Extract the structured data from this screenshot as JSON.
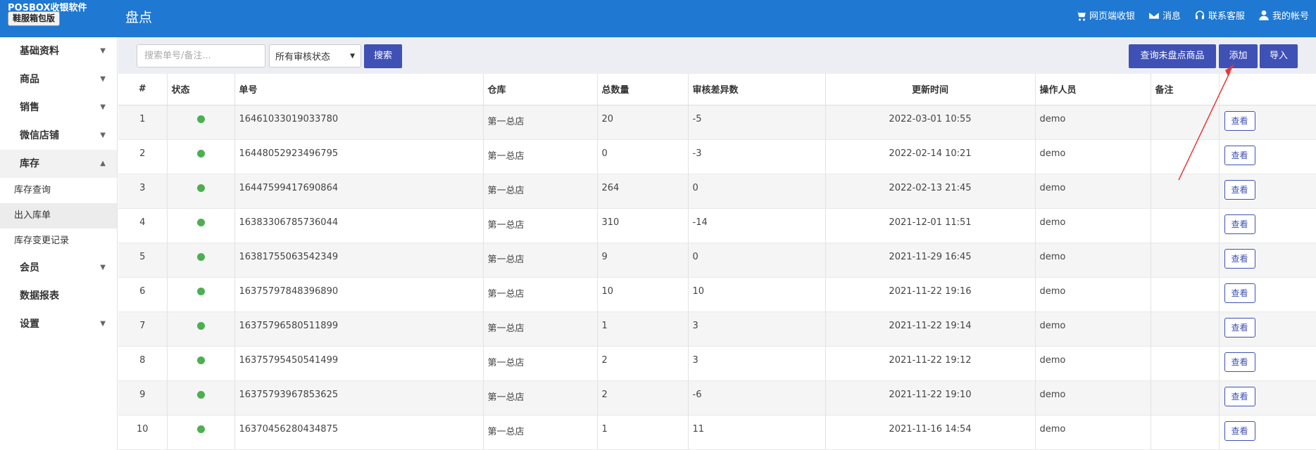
{
  "header": {
    "brand": "POSBOX收银软件",
    "store_type": "鞋服箱包版",
    "page_title": "盘点",
    "nav": [
      {
        "label": "网页端收银",
        "icon": "cart-icon"
      },
      {
        "label": "消息",
        "icon": "mail-icon"
      },
      {
        "label": "联系客服",
        "icon": "headset-icon"
      },
      {
        "label": "我的帐号",
        "icon": "user-icon"
      }
    ]
  },
  "sidebar": {
    "items": [
      {
        "label": "基础资料",
        "caret": "▼"
      },
      {
        "label": "商品",
        "caret": "▼"
      },
      {
        "label": "销售",
        "caret": "▼"
      },
      {
        "label": "微信店铺",
        "caret": "▼"
      },
      {
        "label": "库存",
        "caret": "▲"
      }
    ],
    "sub_items": [
      {
        "label": "库存查询"
      },
      {
        "label": "出入库单"
      },
      {
        "label": "库存变更记录"
      }
    ],
    "items_after": [
      {
        "label": "会员",
        "caret": "▼"
      },
      {
        "label": "数据报表",
        "caret": ""
      },
      {
        "label": "设置",
        "caret": "▼"
      }
    ]
  },
  "toolbar": {
    "search_placeholder": "搜索单号/备注...",
    "status_select": "所有审核状态",
    "search_btn": "搜索",
    "uncounted_btn": "查询未盘点商品",
    "add_btn": "添加",
    "import_btn": "导入"
  },
  "table": {
    "headers": [
      "#",
      "状态",
      "单号",
      "仓库",
      "总数量",
      "审核差异数",
      "更新时间",
      "操作人员",
      "备注",
      ""
    ],
    "view_label": "查看",
    "status_color": "#4caf50",
    "rows": [
      {
        "idx": "1",
        "no": "16461033019033780",
        "warehouse": "第一总店",
        "qty": "20",
        "diff": "-5",
        "time": "2022-03-01 10:55",
        "operator": "demo",
        "note": ""
      },
      {
        "idx": "2",
        "no": "16448052923496795",
        "warehouse": "第一总店",
        "qty": "0",
        "diff": "-3",
        "time": "2022-02-14 10:21",
        "operator": "demo",
        "note": ""
      },
      {
        "idx": "3",
        "no": "16447599417690864",
        "warehouse": "第一总店",
        "qty": "264",
        "diff": "0",
        "time": "2022-02-13 21:45",
        "operator": "demo",
        "note": ""
      },
      {
        "idx": "4",
        "no": "16383306785736044",
        "warehouse": "第一总店",
        "qty": "310",
        "diff": "-14",
        "time": "2021-12-01 11:51",
        "operator": "demo",
        "note": ""
      },
      {
        "idx": "5",
        "no": "16381755063542349",
        "warehouse": "第一总店",
        "qty": "9",
        "diff": "0",
        "time": "2021-11-29 16:45",
        "operator": "demo",
        "note": ""
      },
      {
        "idx": "6",
        "no": "16375797848396890",
        "warehouse": "第一总店",
        "qty": "10",
        "diff": "10",
        "time": "2021-11-22 19:16",
        "operator": "demo",
        "note": ""
      },
      {
        "idx": "7",
        "no": "16375796580511899",
        "warehouse": "第一总店",
        "qty": "1",
        "diff": "3",
        "time": "2021-11-22 19:14",
        "operator": "demo",
        "note": ""
      },
      {
        "idx": "8",
        "no": "16375795450541499",
        "warehouse": "第一总店",
        "qty": "2",
        "diff": "3",
        "time": "2021-11-22 19:12",
        "operator": "demo",
        "note": ""
      },
      {
        "idx": "9",
        "no": "16375793967853625",
        "warehouse": "第一总店",
        "qty": "2",
        "diff": "-6",
        "time": "2021-11-22 19:10",
        "operator": "demo",
        "note": ""
      },
      {
        "idx": "10",
        "no": "16370456280434875",
        "warehouse": "第一总店",
        "qty": "1",
        "diff": "11",
        "time": "2021-11-16 14:54",
        "operator": "demo",
        "note": ""
      }
    ]
  },
  "annotation_color": "#e53935"
}
